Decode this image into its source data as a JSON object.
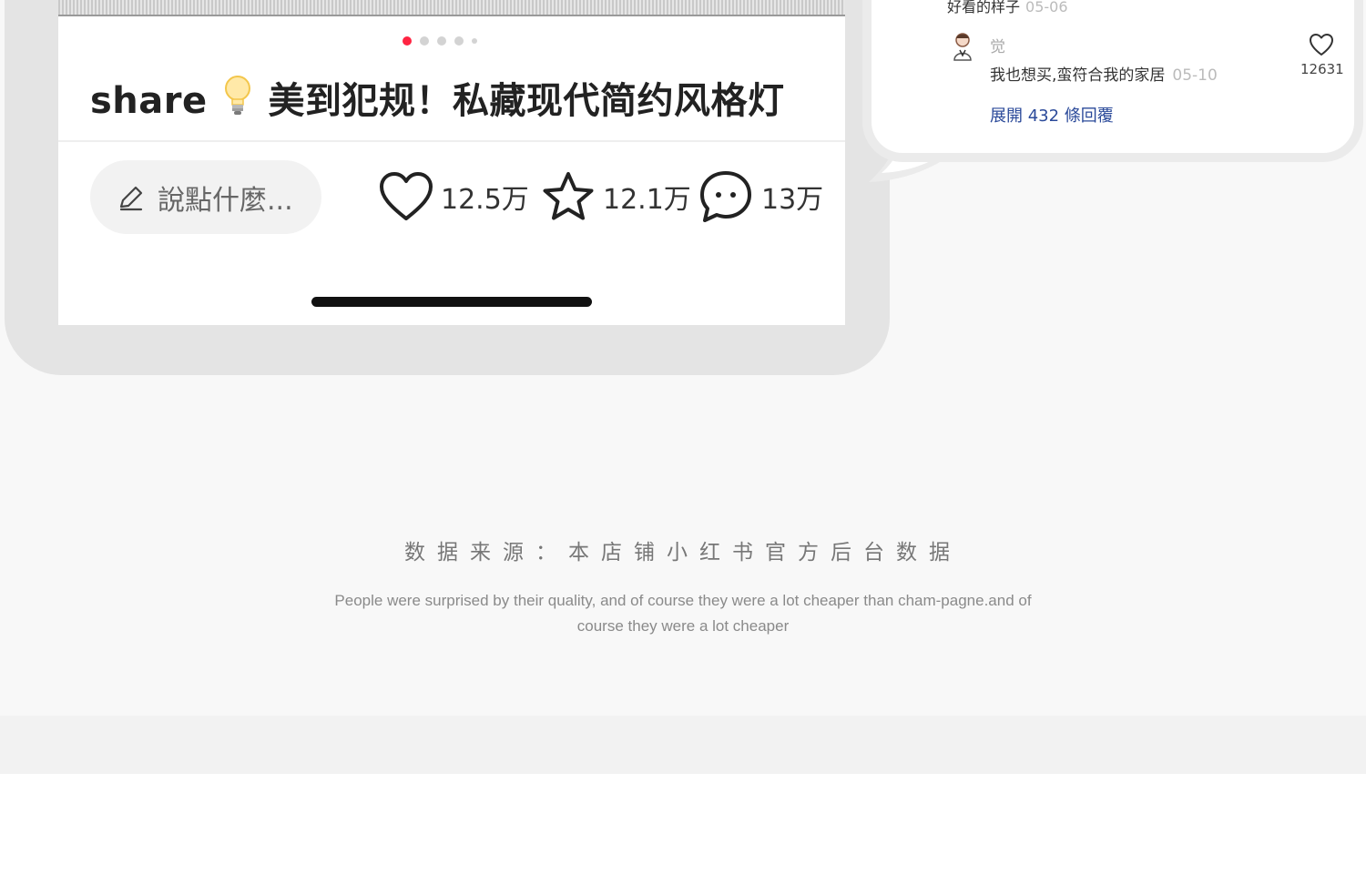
{
  "post": {
    "title_prefix": "share",
    "title_main": "美到犯规！私藏现代简约风格灯",
    "carousel": {
      "total": 5,
      "active_index": 0
    },
    "comment_placeholder": "說點什麼...",
    "stats": {
      "likes": "12.5万",
      "favorites": "12.1万",
      "comments": "13万"
    }
  },
  "comments_panel": {
    "previous_reply": {
      "text": "好看的样子",
      "date": "05-06"
    },
    "reply": {
      "user": "觉",
      "text": "我也想买,蛮符合我的家居",
      "date": "05-10",
      "likes": "12631"
    },
    "expand_label": "展開 432 條回覆"
  },
  "footer": {
    "source": "数据来源：本店铺小红书官方后台数据",
    "caption": "People were surprised by their quality, and of course they were a lot cheaper than cham-pagne.and of course they were a lot cheaper"
  },
  "colors": {
    "accent": "#ff2442",
    "link": "#2b4a9a",
    "frame": "#e4e4e4"
  },
  "icons": [
    "pencil-icon",
    "heart-icon",
    "star-icon",
    "chat-bubble-icon",
    "lightbulb-icon",
    "avatar-icon"
  ]
}
